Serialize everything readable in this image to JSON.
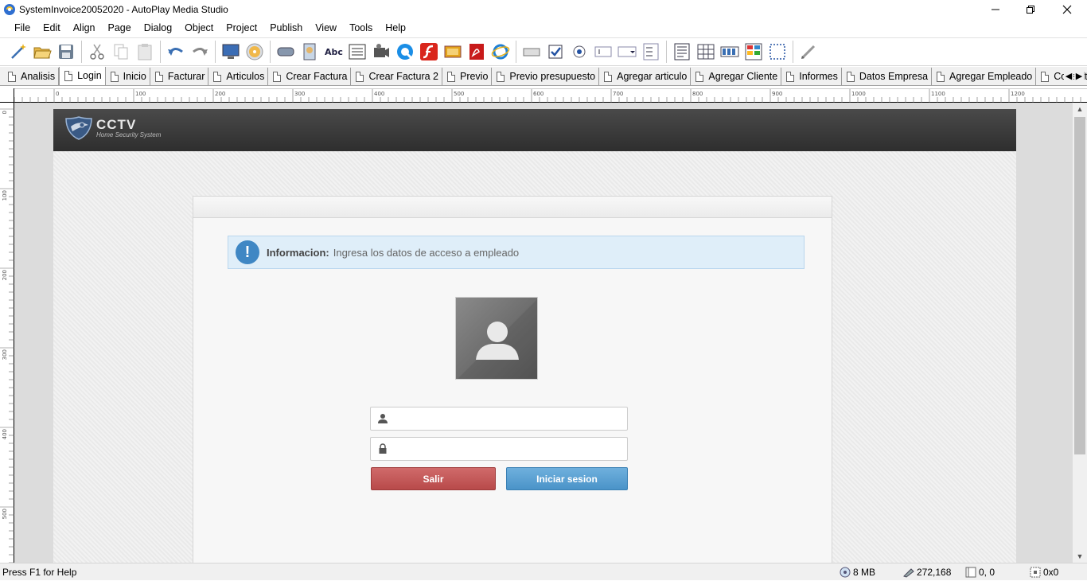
{
  "window": {
    "title": "SystemInvoice20052020 - AutoPlay Media Studio"
  },
  "menu": [
    "File",
    "Edit",
    "Align",
    "Page",
    "Dialog",
    "Object",
    "Project",
    "Publish",
    "View",
    "Tools",
    "Help"
  ],
  "toolbar": {
    "buttons": [
      "wand-icon",
      "open-folder-icon",
      "save-icon",
      "cut-icon",
      "copy-icon",
      "paste-icon",
      "undo-icon",
      "redo-icon",
      "preview-icon",
      "publish-cd-icon",
      "button-object-icon",
      "image-object-icon",
      "label-object-icon",
      "paragraph-object-icon",
      "video-object-icon",
      "quicktime-object-icon",
      "flash-object-icon",
      "slideshow-object-icon",
      "pdf-object-icon",
      "web-object-icon",
      "input-object-icon",
      "checkbox-object-icon",
      "radio-object-icon",
      "tree-object-icon",
      "combobox-object-icon",
      "listbox-object-icon",
      "richtext-object-icon",
      "grid-object-icon",
      "progress-object-icon",
      "xbutton-object-icon",
      "hotspot-object-icon",
      "pencil-icon"
    ]
  },
  "pagetabs": [
    "Analisis",
    "Login",
    "Inicio",
    "Facturar",
    "Articulos",
    "Crear Factura",
    "Crear Factura 2",
    "Previo",
    "Previo presupuesto",
    "Agregar articulo",
    "Agregar Cliente",
    "Informes",
    "Datos Empresa",
    "Agregar Empleado",
    "Consulta"
  ],
  "active_tab": "Login",
  "ruler": {
    "h": [
      "0",
      "100",
      "200",
      "300",
      "400",
      "500",
      "600",
      "700",
      "800",
      "900",
      "1000",
      "1100",
      "1200"
    ],
    "v": [
      "0",
      "100",
      "200",
      "300",
      "400",
      "500"
    ]
  },
  "app": {
    "logo_title": "CCTV",
    "logo_subtitle": "Home Security System",
    "info_label": "Informacion:",
    "info_message": "Ingresa los datos de acceso a empleado",
    "username_value": "",
    "password_value": "",
    "btn_exit": "Salir",
    "btn_login": "Iniciar sesion"
  },
  "status": {
    "help": "Press F1 for Help",
    "memory": "8 MB",
    "cursor": "272,168",
    "position": "0, 0",
    "size": "0x0"
  },
  "colors": {
    "header_dark": "#333333",
    "info_bg": "#dfeef9",
    "info_icon": "#3f87c4",
    "btn_exit": "#c05656",
    "btn_login": "#5aa0d2"
  }
}
